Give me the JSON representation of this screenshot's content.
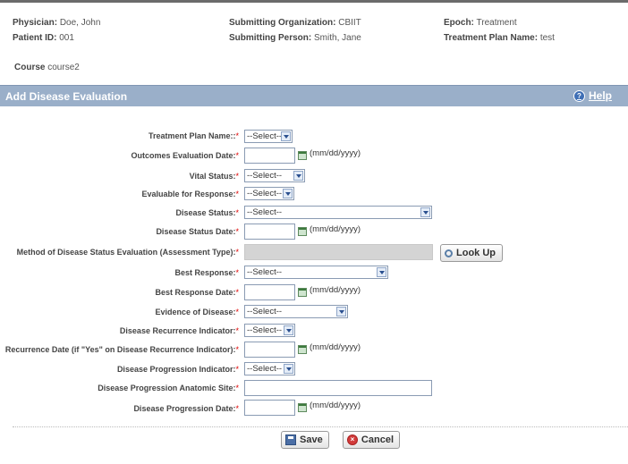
{
  "header": {
    "physician_label": "Physician:",
    "physician_value": "Doe, John",
    "patient_label": "Patient ID:",
    "patient_value": "001",
    "sub_org_label": "Submitting Organization:",
    "sub_org_value": "CBIIT",
    "sub_person_label": "Submitting Person:",
    "sub_person_value": "Smith, Jane",
    "epoch_label": "Epoch:",
    "epoch_value": "Treatment",
    "plan_label": "Treatment Plan Name:",
    "plan_value": "test",
    "course_label": "Course",
    "course_value": "course2"
  },
  "panel": {
    "title": "Add Disease Evaluation",
    "help_label": "Help",
    "help_icon_text": "?"
  },
  "form": {
    "required_marker": "*",
    "date_format": "(mm/dd/yyyy)",
    "labels": {
      "treatment_plan": "Treatment Plan Name::",
      "outcomes_date": "Outcomes Evaluation Date:",
      "vital_status": "Vital Status:",
      "evaluable": "Evaluable for Response:",
      "disease_status": "Disease Status:",
      "disease_status_date": "Disease Status Date:",
      "method": "Method of Disease Status Evaluation (Assessment Type):",
      "best_response": "Best Response:",
      "best_response_date": "Best Response Date:",
      "evidence": "Evidence of Disease:",
      "recurrence_indicator": "Disease Recurrence Indicator:",
      "recurrence_date": "Recurrence Date (if \"Yes\" on Disease Recurrence Indicator):",
      "progression_indicator": "Disease Progression Indicator:",
      "progression_site": "Disease Progression Anatomic Site:",
      "progression_date": "Disease Progression Date:"
    },
    "values": {
      "treatment_plan": "--Select--",
      "vital_status": "--Select--",
      "evaluable": "--Select--",
      "disease_status": "--Select--",
      "best_response": "--Select--",
      "evidence": "--Select--",
      "recurrence_indicator": "--Select--",
      "progression_indicator": "--Select--",
      "outcomes_date": "",
      "disease_status_date": "",
      "method": "",
      "best_response_date": "",
      "recurrence_date": "",
      "progression_site": "",
      "progression_date": ""
    },
    "lookup_label": "Look Up"
  },
  "actions": {
    "save_label": "Save",
    "cancel_label": "Cancel"
  }
}
